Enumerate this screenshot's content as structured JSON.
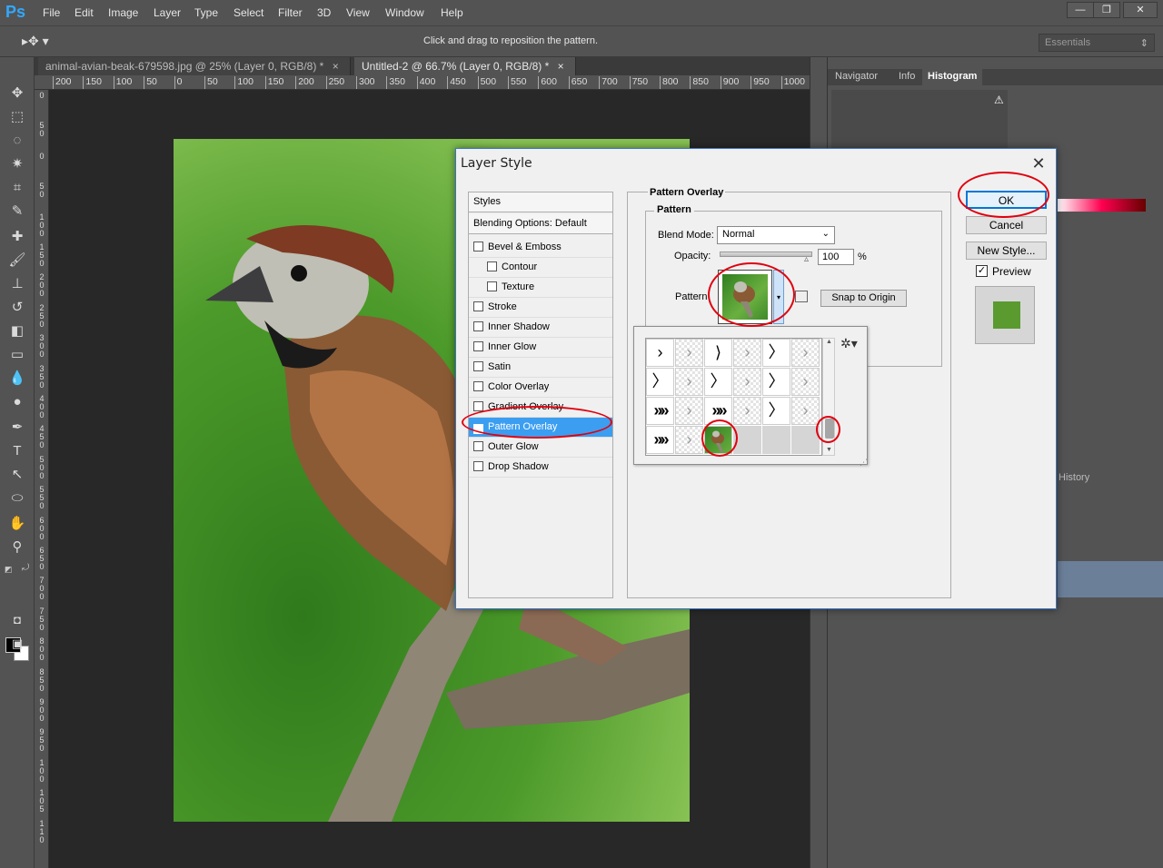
{
  "app": {
    "logo": "Ps"
  },
  "menu": [
    "File",
    "Edit",
    "Image",
    "Layer",
    "Type",
    "Select",
    "Filter",
    "3D",
    "View",
    "Window",
    "Help"
  ],
  "window_controls": {
    "minimize": "—",
    "restore": "❐",
    "close": "✕"
  },
  "options_bar": {
    "hint": "Click and drag to reposition the pattern.",
    "workspace": "Essentials"
  },
  "doc_tabs": [
    {
      "label": "animal-avian-beak-679598.jpg @ 25% (Layer 0, RGB/8) *",
      "close": "×"
    },
    {
      "label": "Untitled-2 @ 66.7% (Layer 0, RGB/8) *",
      "close": "×"
    }
  ],
  "ruler_top": [
    "200",
    "150",
    "100",
    "50",
    "0",
    "50",
    "100",
    "150",
    "200",
    "250",
    "300",
    "350",
    "400",
    "450",
    "500",
    "550",
    "600",
    "650",
    "700",
    "750",
    "800",
    "850",
    "900",
    "950",
    "1000"
  ],
  "ruler_left": [
    "0",
    "5 0",
    "0",
    "5 0",
    "1 0 0",
    "1 5 0",
    "2 0 0",
    "2 5 0",
    "3 0 0",
    "3 5 0",
    "4 0 0",
    "4 5 0",
    "5 0 0",
    "5 5 0",
    "6 0 0",
    "6 5 0",
    "7 0 0",
    "7 5 0",
    "8 0 0",
    "8 5 0",
    "9 0 0",
    "9 5 0",
    "1 0 0",
    "1 0 5",
    "1 1 0"
  ],
  "panels": {
    "tabs": [
      "Navigator",
      "Info",
      "Histogram"
    ],
    "history": "History"
  },
  "dialog": {
    "title": "Layer Style",
    "close": "✕",
    "styles_header": "Styles",
    "blending_options": "Blending Options: Default",
    "styles": [
      {
        "label": "Bevel & Emboss",
        "checked": false,
        "indent": false
      },
      {
        "label": "Contour",
        "checked": false,
        "indent": true
      },
      {
        "label": "Texture",
        "checked": false,
        "indent": true
      },
      {
        "label": "Stroke",
        "checked": false,
        "indent": false
      },
      {
        "label": "Inner Shadow",
        "checked": false,
        "indent": false
      },
      {
        "label": "Inner Glow",
        "checked": false,
        "indent": false
      },
      {
        "label": "Satin",
        "checked": false,
        "indent": false
      },
      {
        "label": "Color Overlay",
        "checked": false,
        "indent": false
      },
      {
        "label": "Gradient Overlay",
        "checked": false,
        "indent": false
      },
      {
        "label": "Pattern Overlay",
        "checked": true,
        "indent": false,
        "selected": true
      },
      {
        "label": "Outer Glow",
        "checked": false,
        "indent": false
      },
      {
        "label": "Drop Shadow",
        "checked": false,
        "indent": false
      }
    ],
    "section_title": "Pattern Overlay",
    "group_title": "Pattern",
    "blend_mode_label": "Blend Mode:",
    "blend_mode_value": "Normal",
    "opacity_label": "Opacity:",
    "opacity_value": "100",
    "opacity_unit": "%",
    "pattern_label": "Pattern",
    "snap_button": "Snap to Origin",
    "buttons": {
      "ok": "OK",
      "cancel": "Cancel",
      "new_style": "New Style..."
    },
    "preview_label": "Preview",
    "preview_checked": true
  },
  "picker": {
    "rows": [
      [
        "arrow-thin",
        "checker",
        "arrow-wavy",
        "checker",
        "arrow-chevron",
        "checker"
      ],
      [
        "arrow-chevron",
        "checker",
        "arrow-chevron",
        "checker",
        "arrow-chevron",
        "checker"
      ],
      [
        "arrow-dense",
        "checker",
        "arrow-dense",
        "checker",
        "arrow-chevron",
        "checker"
      ],
      [
        "arrow-dense",
        "checker",
        "bird-photo",
        "empty",
        "empty",
        "empty"
      ]
    ],
    "glyphs": {
      "arrow-thin": "›",
      "arrow-wavy": "⟩",
      "arrow-chevron": "〉",
      "arrow-dense": "»»",
      "checker": "›"
    }
  }
}
